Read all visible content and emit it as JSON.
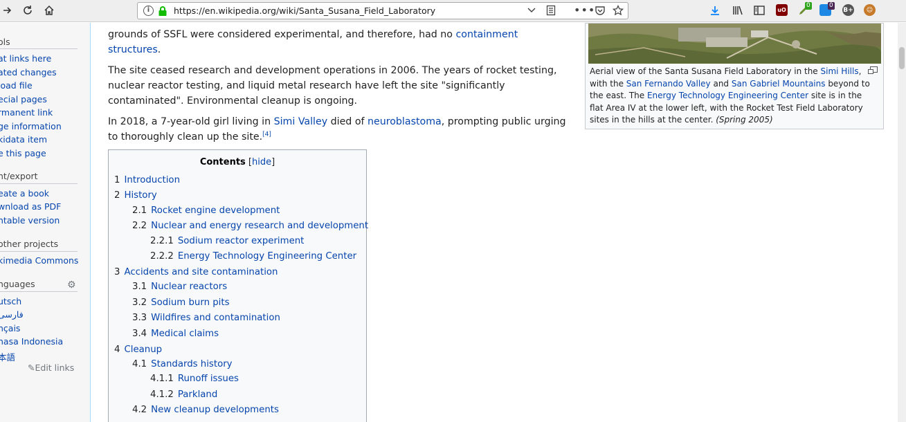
{
  "browser": {
    "url": "https://en.wikipedia.org/wiki/Santa_Susana_Field_Laboratory",
    "ext_badges": [
      "0",
      "0"
    ],
    "ext_label_b": "B+"
  },
  "sidebar": {
    "tools_heading": "ols",
    "tools": [
      "at links here",
      "ated changes",
      "load file",
      "ecial pages",
      "rmanent link",
      "ge information",
      "kidata item",
      "e this page"
    ],
    "print_heading": "nt/export",
    "print": [
      "eate a book",
      "wnload as PDF",
      "ntable version"
    ],
    "other_heading": "other projects",
    "other": [
      "kimedia Commons"
    ],
    "languages_heading": "nguages",
    "languages": [
      "utsch",
      "فارسی",
      "nçais",
      "hasa Indonesia",
      "本語"
    ],
    "edit_links": "Edit links"
  },
  "article": {
    "p1_text1": "grounds of SSFL were considered experimental, and therefore, had no ",
    "p1_link": "containment structures",
    "p1_end": ".",
    "p2": "The site ceased research and development operations in 2006. The years of rocket testing, nuclear reactor testing, and liquid metal research have left the site \"significantly contaminated\". Environmental cleanup is ongoing.",
    "p3_text1": "In 2018, a 7-year-old girl living in ",
    "p3_link1": "Simi Valley",
    "p3_text2": " died of ",
    "p3_link2": "neuroblastoma",
    "p3_text3": ", prompting public urging to thoroughly clean up the site.",
    "p3_ref": "[4]"
  },
  "thumb": {
    "c1": "Aerial view of the Santa Susana Field Laboratory in the ",
    "l1": "Simi Hills",
    "c2": ", with the ",
    "l2": "San Fernando Valley",
    "c3": " and ",
    "l3": "San Gabriel Mountains",
    "c4": " beyond to the east. The ",
    "l4": "Energy Technology Engineering Center",
    "c5": " site is in the flat Area IV at the lower left, with the Rocket Test Field Laboratory sites in the hills at the center. ",
    "c6": "(Spring 2005)"
  },
  "toc": {
    "title": "Contents",
    "hide_open": " [",
    "hide": "hide",
    "hide_close": "]",
    "items": [
      {
        "num": "1",
        "label": "Introduction"
      },
      {
        "num": "2",
        "label": "History"
      },
      {
        "num": "2.1",
        "label": "Rocket engine development"
      },
      {
        "num": "2.2",
        "label": "Nuclear and energy research and development"
      },
      {
        "num": "2.2.1",
        "label": "Sodium reactor experiment"
      },
      {
        "num": "2.2.2",
        "label": "Energy Technology Engineering Center"
      },
      {
        "num": "3",
        "label": "Accidents and site contamination"
      },
      {
        "num": "3.1",
        "label": "Nuclear reactors"
      },
      {
        "num": "3.2",
        "label": "Sodium burn pits"
      },
      {
        "num": "3.3",
        "label": "Wildfires and contamination"
      },
      {
        "num": "3.4",
        "label": "Medical claims"
      },
      {
        "num": "4",
        "label": "Cleanup"
      },
      {
        "num": "4.1",
        "label": "Standards history"
      },
      {
        "num": "4.1.1",
        "label": "Runoff issues"
      },
      {
        "num": "4.1.2",
        "label": "Parkland"
      },
      {
        "num": "4.2",
        "label": "New cleanup developments"
      }
    ]
  }
}
